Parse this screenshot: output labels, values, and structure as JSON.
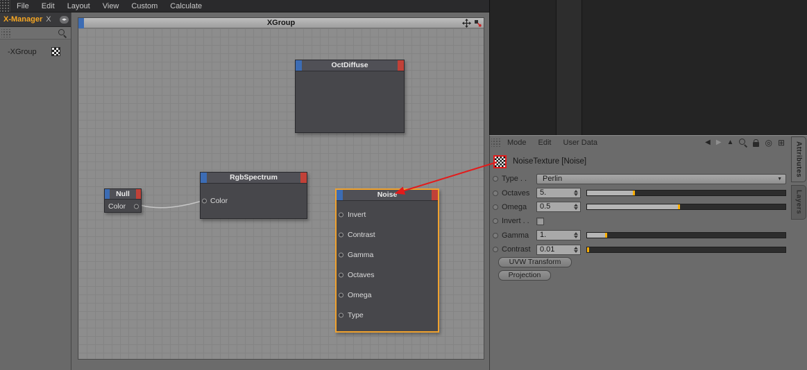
{
  "colors": {
    "accent_orange": "#f5a623",
    "node_blue": "#3c6cb4",
    "node_red": "#c14138",
    "selection_orange": "#f0a22e",
    "slider_tick": "#ffae00",
    "annotation_red": "#e31b1b"
  },
  "menubar": {
    "items": [
      "File",
      "Edit",
      "Layout",
      "View",
      "Custom",
      "Calculate"
    ]
  },
  "xmanager": {
    "tab_label": "X-Manager",
    "close_label": "X",
    "nav_arrows": "◂▸",
    "tree": {
      "item": "-XGroup"
    }
  },
  "editor": {
    "group_title": "XGroup",
    "nodes": {
      "octdiffuse": {
        "title": "OctDiffuse"
      },
      "rgbspectrum": {
        "title": "RgbSpectrum",
        "ports": [
          "Color"
        ]
      },
      "null": {
        "title": "Null",
        "ports": [
          "Color"
        ]
      },
      "noise": {
        "title": "Noise",
        "selected": true,
        "ports": [
          "Invert",
          "Contrast",
          "Gamma",
          "Octaves",
          "Omega",
          "Type"
        ]
      }
    }
  },
  "attributes": {
    "menu_items": [
      "Mode",
      "Edit",
      "User Data"
    ],
    "header_icons": {
      "back": "◀",
      "forward": "▶",
      "up": "▲",
      "circle": "◎",
      "new_window": "⊞"
    },
    "object_title": "NoiseTexture [Noise]",
    "dropdown_arrow": "▼",
    "rows": [
      {
        "label": "Type . .",
        "type": "dropdown",
        "value": "Perlin"
      },
      {
        "label": "Octaves",
        "type": "slider",
        "value": "5.",
        "slider_pct": 24
      },
      {
        "label": "Omega",
        "type": "slider",
        "value": "0.5",
        "slider_pct": 47
      },
      {
        "label": "Invert . .",
        "type": "checkbox",
        "checked": false
      },
      {
        "label": "Gamma",
        "type": "slider",
        "value": "1.",
        "slider_pct": 10
      },
      {
        "label": "Contrast",
        "type": "slider",
        "value": "0.01",
        "slider_pct": 1
      }
    ],
    "buttons": [
      "UVW Transform",
      "Projection"
    ],
    "side_tabs": [
      "Attributes",
      "Layers"
    ]
  }
}
